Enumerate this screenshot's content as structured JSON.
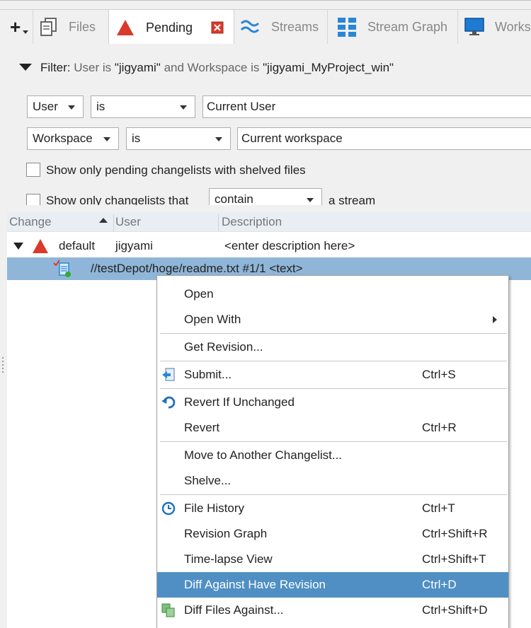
{
  "tabs": [
    {
      "label": "Files",
      "icon": "files-icon"
    },
    {
      "label": "Pending",
      "icon": "pending-triangle-icon",
      "close": "close-tab-icon"
    },
    {
      "label": "Streams",
      "icon": "streams-icon"
    },
    {
      "label": "Stream Graph",
      "icon": "stream-graph-icon"
    },
    {
      "label": "Works",
      "icon": "workspace-monitor-icon"
    }
  ],
  "filter": {
    "prefix": "Filter:",
    "part1": "User is ",
    "user": "\"jigyami\"",
    "part2": " and Workspace is ",
    "workspace": "\"jigyami_MyProject_win\""
  },
  "rows": {
    "r1": {
      "field": "User",
      "op": "is",
      "value": "Current User"
    },
    "r2": {
      "field": "Workspace",
      "op": "is",
      "value": "Current workspace"
    }
  },
  "options": {
    "shelved_label": "Show only pending changelists with shelved files",
    "stream_label_a": "Show only changelists that",
    "stream_select": "contain",
    "stream_label_b": "a stream"
  },
  "table": {
    "headers": [
      "Change",
      "User",
      "Description"
    ],
    "changelist": {
      "change": "default",
      "user": "jigyami",
      "description": "<enter description here>"
    },
    "file": "//testDepot/hoge/readme.txt #1/1 <text>"
  },
  "menu": {
    "open": "Open",
    "open_with": "Open With",
    "get_revision": "Get Revision...",
    "submit": "Submit...",
    "submit_sc": "Ctrl+S",
    "revert_unchanged": "Revert If Unchanged",
    "revert": "Revert",
    "revert_sc": "Ctrl+R",
    "move": "Move to Another Changelist...",
    "shelve": "Shelve...",
    "history": "File History",
    "history_sc": "Ctrl+T",
    "revgraph": "Revision Graph",
    "revgraph_sc": "Ctrl+Shift+R",
    "timelapse": "Time-lapse View",
    "timelapse_sc": "Ctrl+Shift+T",
    "diff_have": "Diff Against Have Revision",
    "diff_have_sc": "Ctrl+D",
    "diff_files": "Diff Files Against...",
    "diff_files_sc": "Ctrl+Shift+D"
  },
  "colors": {
    "accent_red": "#d93a2b",
    "menu_highlight": "#4f8fc3",
    "selected_row": "#8fb6d8"
  }
}
